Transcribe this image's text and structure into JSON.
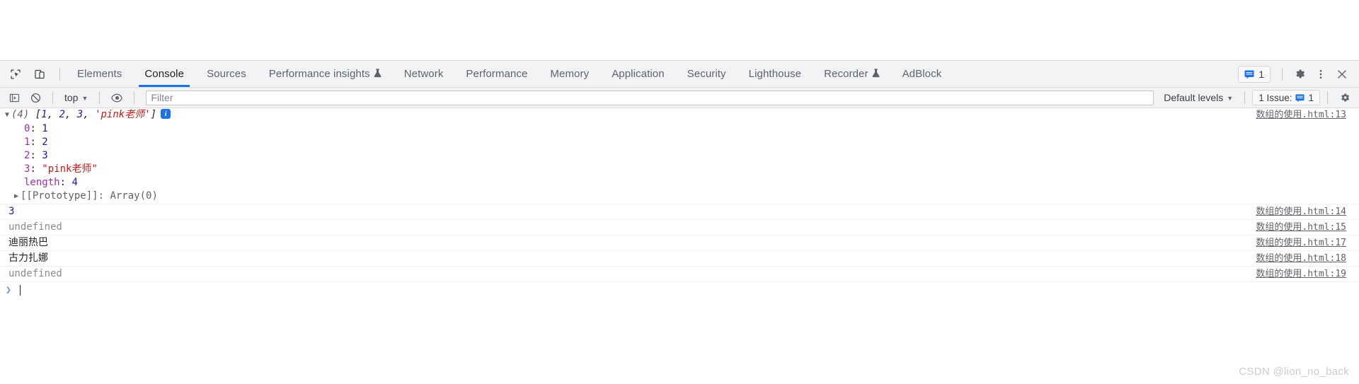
{
  "window": {
    "watermark": "CSDN @lion_no_back"
  },
  "tabbar": {
    "icons": {
      "inspect": "inspect-element-icon",
      "device": "device-toolbar-icon"
    },
    "tabs": [
      {
        "label": "Elements",
        "active": false,
        "beaker": ""
      },
      {
        "label": "Console",
        "active": true,
        "beaker": ""
      },
      {
        "label": "Sources",
        "active": false,
        "beaker": ""
      },
      {
        "label": "Performance insights",
        "active": false,
        "beaker": "⚗"
      },
      {
        "label": "Network",
        "active": false,
        "beaker": ""
      },
      {
        "label": "Performance",
        "active": false,
        "beaker": ""
      },
      {
        "label": "Memory",
        "active": false,
        "beaker": ""
      },
      {
        "label": "Application",
        "active": false,
        "beaker": ""
      },
      {
        "label": "Security",
        "active": false,
        "beaker": ""
      },
      {
        "label": "Lighthouse",
        "active": false,
        "beaker": ""
      },
      {
        "label": "Recorder",
        "active": false,
        "beaker": "⚗"
      },
      {
        "label": "AdBlock",
        "active": false,
        "beaker": ""
      }
    ],
    "issues_count": "1",
    "settings_label": "settings-gear-icon",
    "more_label": "more-options-icon",
    "close_label": "close-icon"
  },
  "console_toolbar": {
    "sidebar_toggle": "console-sidebar-icon",
    "clear_label": "clear-console-icon",
    "context": "top",
    "eye_label": "live-expression-icon",
    "filter_placeholder": "Filter",
    "filter_value": "",
    "levels": "Default levels",
    "issues_text": "1 Issue:",
    "issues_count": "1",
    "settings_label": "console-settings-icon"
  },
  "colors": {
    "accent": "#1a73e8",
    "toolbar_bg": "#f1f3f4",
    "number": "#1a1aa6",
    "string": "#c41a16",
    "key": "#9d2dad",
    "undefined": "#888c8f"
  },
  "console": {
    "group": {
      "expanded": true,
      "preview_count": "(4)",
      "preview_text": "[1, 2, 3, 'pink老师']",
      "badge": "i",
      "link": "数组的使用.html:13",
      "props": [
        {
          "key": "0",
          "sep": ": ",
          "value": "1",
          "value_kind": "num"
        },
        {
          "key": "1",
          "sep": ": ",
          "value": "2",
          "value_kind": "num"
        },
        {
          "key": "2",
          "sep": ": ",
          "value": "3",
          "value_kind": "num"
        },
        {
          "key": "3",
          "sep": ": ",
          "value": "\"pink老师\"",
          "value_kind": "str"
        },
        {
          "key": "length",
          "sep": ": ",
          "value": "4",
          "value_kind": "num"
        }
      ],
      "prototype": {
        "key": "[[Prototype]]",
        "sep": ": ",
        "value": "Array(0)"
      }
    },
    "messages": [
      {
        "text": "3",
        "kind": "num",
        "link": "数组的使用.html:14"
      },
      {
        "text": "undefined",
        "kind": "undef",
        "link": "数组的使用.html:15"
      },
      {
        "text": "迪丽热巴",
        "kind": "cjk",
        "link": "数组的使用.html:17"
      },
      {
        "text": "古力扎娜",
        "kind": "cjk",
        "link": "数组的使用.html:18"
      },
      {
        "text": "undefined",
        "kind": "undef",
        "link": "数组的使用.html:19"
      }
    ],
    "prompt": {
      "caret": "❯",
      "value": ""
    }
  }
}
